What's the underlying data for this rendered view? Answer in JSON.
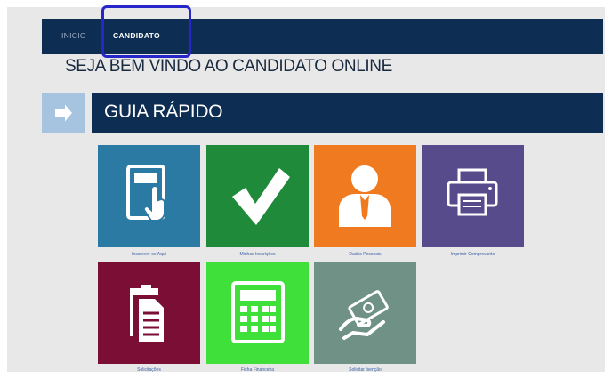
{
  "nav": {
    "items": [
      {
        "label": "INICIO"
      },
      {
        "label": "CANDIDATO"
      }
    ]
  },
  "welcome_text": "SEJA BEM VINDO AO CANDIDATO ONLINE",
  "guide": {
    "title": "GUIA RÁPIDO",
    "icon": "arrow-right-icon"
  },
  "tiles": [
    {
      "label": "Inscrever-se Aqui",
      "color": "#2b7aa3",
      "icon": "tablet-touch-icon"
    },
    {
      "label": "Minhas Inscrições",
      "color": "#1e8a3a",
      "icon": "checkmark-icon"
    },
    {
      "label": "Dados Pessoais",
      "color": "#f07a1f",
      "icon": "person-icon"
    },
    {
      "label": "Imprimir Comprovante",
      "color": "#574b8c",
      "icon": "printer-icon"
    },
    {
      "label": "Solicitações",
      "color": "#7b0e35",
      "icon": "clipboard-icon"
    },
    {
      "label": "Ficha Financeira",
      "color": "#3fe03a",
      "icon": "calculator-icon"
    },
    {
      "label": "Solicitar Isenção",
      "color": "#6f9186",
      "icon": "money-hand-icon"
    }
  ],
  "colors": {
    "navbar": "#0d2d52",
    "guide_icon_bg": "#a6c3df",
    "annotation_box": "#2727c9"
  }
}
